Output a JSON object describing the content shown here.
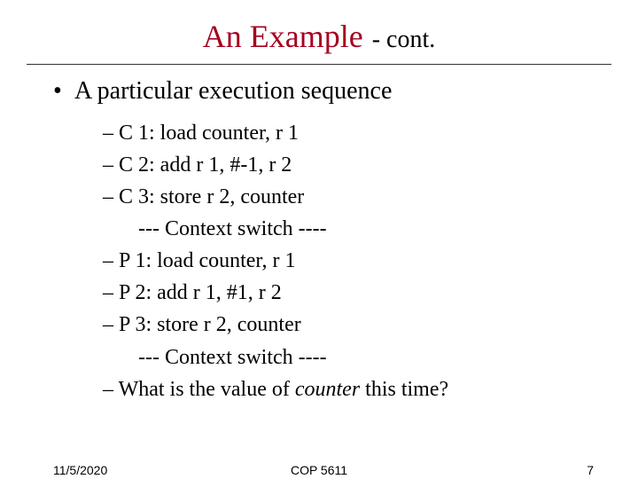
{
  "title": {
    "main": "An Example",
    "sub": "- cont."
  },
  "bullet": "A particular execution sequence",
  "items": {
    "c1": "– C 1: load counter, r 1",
    "c2": "– C 2: add r 1, #-1, r 2",
    "c3": "– C 3: store r 2, counter",
    "switch1": "--- Context switch ----",
    "p1": "– P 1:  load counter, r 1",
    "p2": "– P 2:  add  r 1, #1, r 2",
    "p3": "– P 3:  store r 2, counter",
    "switch2": "--- Context switch ----",
    "q_prefix": "– What is the value of ",
    "q_em": "counter",
    "q_suffix": " this time?"
  },
  "footer": {
    "date": "11/5/2020",
    "course": "COP 5611",
    "page": "7"
  }
}
